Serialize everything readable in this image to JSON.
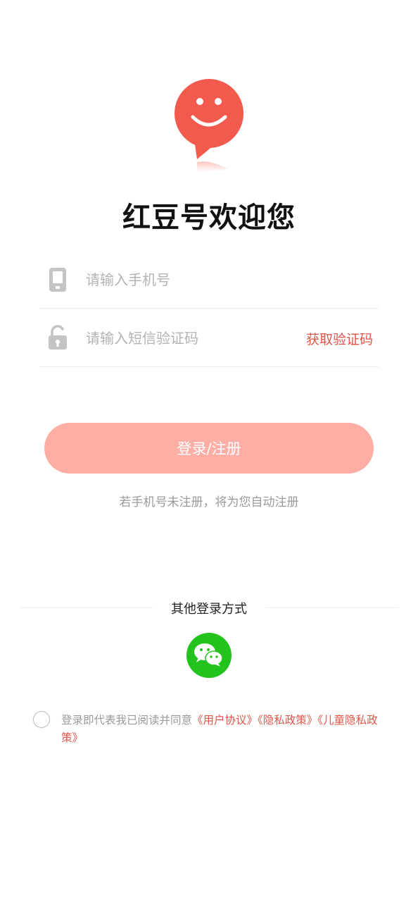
{
  "app": {
    "welcome_title": "红豆号欢迎您"
  },
  "form": {
    "phone_placeholder": "请输入手机号",
    "code_placeholder": "请输入短信验证码",
    "get_code_label": "获取验证码",
    "login_label": "登录/注册",
    "auto_register_note": "若手机号未注册，将为您自动注册"
  },
  "other_login": {
    "title": "其他登录方式",
    "methods": [
      {
        "icon": "wechat-icon",
        "color": "#22c31c"
      }
    ]
  },
  "agreement": {
    "prefix": "登录即代表我已阅读并同意",
    "user_agreement": "《用户协议》",
    "privacy_policy": "《隐私政策》",
    "children_privacy": "《儿童隐私政策》"
  },
  "colors": {
    "brand": "#f25a4e",
    "link": "#e1554a",
    "login_button": "#ffaea5",
    "wechat": "#22c31c"
  }
}
